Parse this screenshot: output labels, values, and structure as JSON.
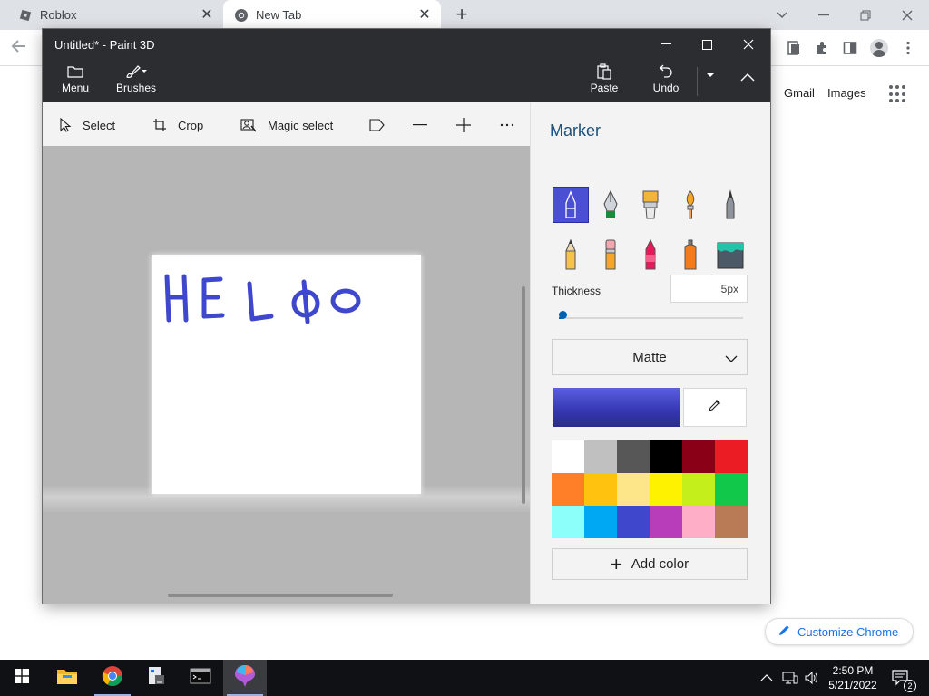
{
  "browser": {
    "tabs": [
      {
        "label": "Roblox"
      },
      {
        "label": "New Tab"
      }
    ],
    "links": {
      "gmail": "Gmail",
      "images": "Images"
    },
    "customize_label": "Customize Chrome"
  },
  "paint3d": {
    "title": "Untitled* - Paint 3D",
    "ribbon": {
      "menu": "Menu",
      "brushes": "Brushes",
      "paste": "Paste",
      "undo": "Undo"
    },
    "tools": {
      "select": "Select",
      "crop": "Crop",
      "magic_select": "Magic select"
    },
    "canvas_text": "HELΦO",
    "panel": {
      "title": "Marker",
      "brush_icons": [
        "marker-icon",
        "calligraphy-pen-icon",
        "oil-brush-icon",
        "watercolor-icon",
        "pixel-pen-icon",
        "pencil-icon",
        "eraser-icon",
        "crayon-icon",
        "spray-can-icon",
        "fill-icon"
      ],
      "thickness_label": "Thickness",
      "thickness_value": "5px",
      "finish": "Matte",
      "current_color": "#4044c4",
      "add_color": "Add color",
      "palette": [
        "#ffffff",
        "#c0c0c0",
        "#575757",
        "#000000",
        "#8a0016",
        "#ec1c24",
        "#ff7e27",
        "#ffc20e",
        "#fde68a",
        "#fff200",
        "#c4ef1b",
        "#12c84a",
        "#8cfffb",
        "#00a8f3",
        "#3f48cc",
        "#b83dba",
        "#ffaec8",
        "#b97a56"
      ]
    }
  },
  "taskbar": {
    "time": "2:50 PM",
    "date": "5/21/2022",
    "notifications": "2"
  }
}
